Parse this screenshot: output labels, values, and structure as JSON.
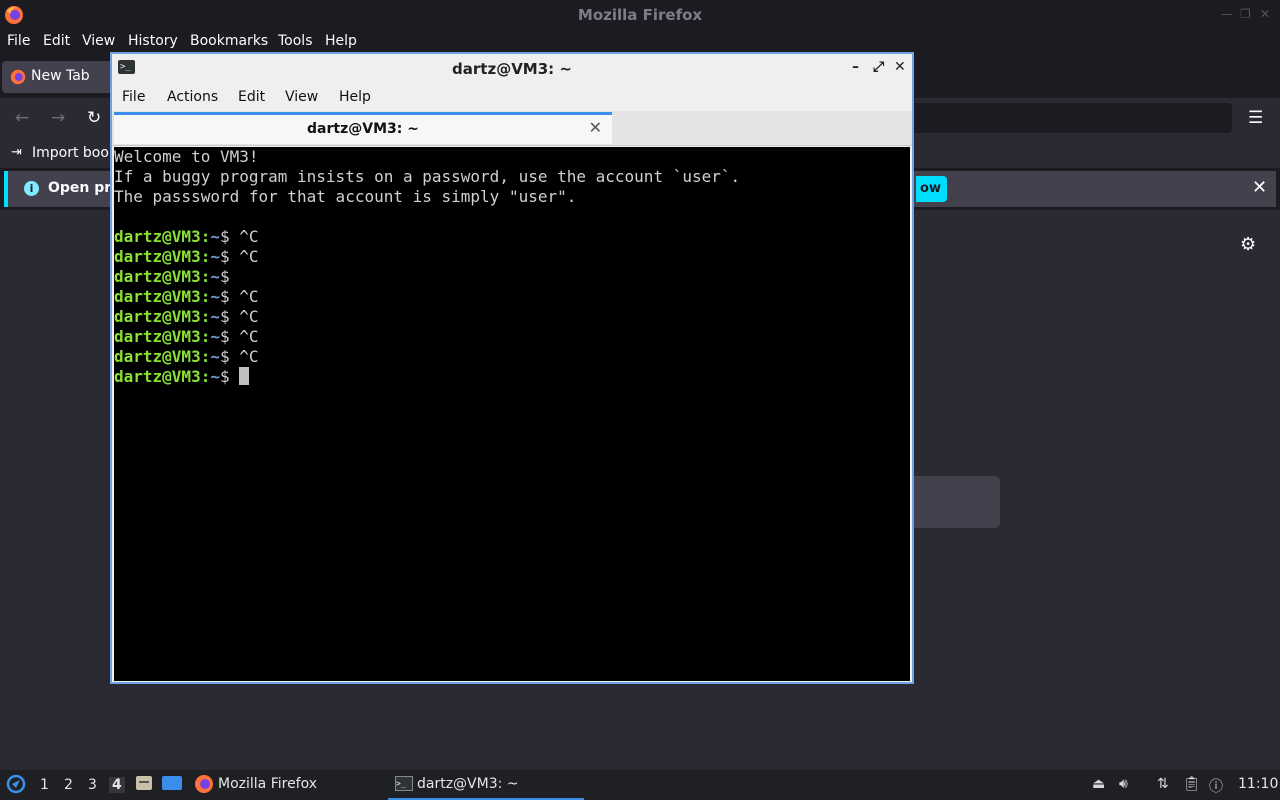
{
  "firefox": {
    "window_title": "Mozilla Firefox",
    "menu": [
      "File",
      "Edit",
      "View",
      "History",
      "Bookmarks",
      "Tools",
      "Help"
    ],
    "tab_label": "New Tab",
    "bookmarks_item": "Import book",
    "infobar_text": "Open pre",
    "infobar_button": "ow"
  },
  "terminal": {
    "title": "dartz@VM3: ~",
    "menu": [
      "File",
      "Actions",
      "Edit",
      "View",
      "Help"
    ],
    "tab_label": "dartz@VM3: ~",
    "output": [
      "Welcome to VM3!",
      "If a buggy program insists on a password, use the account `user`.",
      "The passsword for that account is simply \"user\".",
      ""
    ],
    "prompt_user": "dartz@VM3",
    "prompt_sep": ":",
    "prompt_path": "~",
    "prompt_sym": "$ ",
    "commands": [
      "^C",
      "^C",
      "",
      "^C",
      "^C",
      "^C",
      "^C",
      ""
    ]
  },
  "taskbar": {
    "workspaces": [
      "1",
      "2",
      "3",
      "4"
    ],
    "active_workspace": "4",
    "tasks": [
      "Mozilla Firefox",
      "dartz@VM3: ~"
    ],
    "clock": "11:10"
  },
  "colors": {
    "prompt_user": "#8ae234",
    "prompt_path": "#729fcf",
    "accent": "#3b8eea",
    "infobar_accent": "#00ddff"
  }
}
